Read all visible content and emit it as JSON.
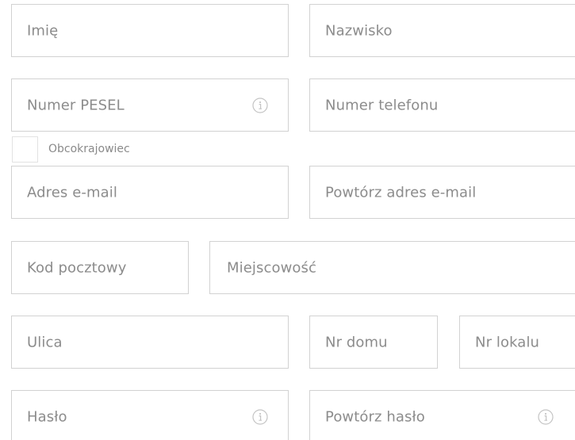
{
  "form": {
    "first_name": {
      "placeholder": "Imię"
    },
    "last_name": {
      "placeholder": "Nazwisko"
    },
    "pesel": {
      "placeholder": "Numer PESEL",
      "icon": "info-icon"
    },
    "phone": {
      "placeholder": "Numer telefonu"
    },
    "foreigner": {
      "label": "Obcokrajowiec",
      "checked": false
    },
    "email": {
      "placeholder": "Adres e-mail"
    },
    "email_repeat": {
      "placeholder": "Powtórz adres e-mail"
    },
    "postal_code": {
      "placeholder": "Kod pocztowy"
    },
    "city": {
      "placeholder": "Miejscowość"
    },
    "street": {
      "placeholder": "Ulica"
    },
    "house_number": {
      "placeholder": "Nr domu"
    },
    "apartment_number": {
      "placeholder": "Nr lokalu"
    },
    "password": {
      "placeholder": "Hasło",
      "icon": "info-icon"
    },
    "password_repeat": {
      "placeholder": "Powtórz hasło",
      "icon": "info-icon"
    }
  },
  "colors": {
    "border": "#d2d2d2",
    "placeholder": "#8c8c8c",
    "icon": "#c4c4c4"
  }
}
